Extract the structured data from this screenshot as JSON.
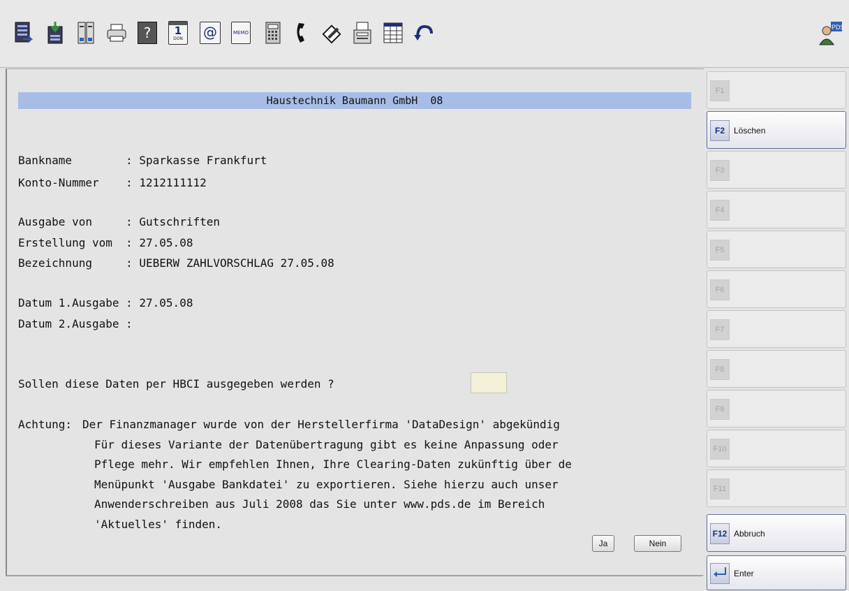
{
  "toolbar": {
    "icons": [
      "export-document-icon",
      "download-document-icon",
      "binder-icon",
      "printer-icon",
      "help-icon",
      "calendar-icon",
      "email-icon",
      "memo-icon",
      "calculator-icon",
      "phone-icon",
      "edit-icon",
      "fax-icon",
      "spreadsheet-icon",
      "undo-icon"
    ],
    "help_glyph": "?",
    "calendar_text": "1",
    "calendar_sub": "DON",
    "email_glyph": "@",
    "memo_text": "MEMO",
    "logo_text": "PDS"
  },
  "header": {
    "company": "Haustechnik Baumann GmbH  08"
  },
  "fields": [
    {
      "label": "Bankname        ",
      "value": ": Sparkasse Frankfurt"
    },
    {
      "label": "Konto-Nummer    ",
      "value": ": 1212111112"
    },
    {
      "label": "Ausgabe von     ",
      "value": ": Gutschriften"
    },
    {
      "label": "Erstellung vom  ",
      "value": ": 27.05.08"
    },
    {
      "label": "Bezeichnung     ",
      "value": ": UEBERW ZAHLVORSCHLAG 27.05.08"
    },
    {
      "label": "Datum 1.Ausgabe ",
      "value": ": 27.05.08"
    },
    {
      "label": "Datum 2.Ausgabe ",
      "value": ":"
    }
  ],
  "question": "Sollen diese Daten per HBCI ausgegeben werden ?",
  "hbci_input_value": "",
  "notice": {
    "prefix": "Achtung:",
    "lines": [
      "Der Finanzmanager wurde von der Herstellerfirma 'DataDesign' abgekündig",
      "Für dieses Variante der Datenübertragung gibt es keine Anpassung oder",
      "Pflege mehr. Wir empfehlen Ihnen, Ihre Clearing-Daten zukünftig über de",
      "Menüpunkt 'Ausgabe Bankdatei' zu exportieren. Siehe hierzu auch unser",
      "Anwenderschreiben aus Juli 2008 das Sie unter www.pds.de im Bereich",
      "'Aktuelles' finden."
    ]
  },
  "buttons": {
    "yes": "Ja",
    "no": "Nein"
  },
  "fkeys": [
    {
      "key": "F1",
      "label": "",
      "enabled": false
    },
    {
      "key": "F2",
      "label": "Löschen",
      "enabled": true
    },
    {
      "key": "F3",
      "label": "",
      "enabled": false
    },
    {
      "key": "F4",
      "label": "",
      "enabled": false
    },
    {
      "key": "F5",
      "label": "",
      "enabled": false
    },
    {
      "key": "F6",
      "label": "",
      "enabled": false
    },
    {
      "key": "F7",
      "label": "",
      "enabled": false
    },
    {
      "key": "F8",
      "label": "",
      "enabled": false
    },
    {
      "key": "F9",
      "label": "",
      "enabled": false
    },
    {
      "key": "F10",
      "label": "",
      "enabled": false
    },
    {
      "key": "F11",
      "label": "",
      "enabled": false
    },
    {
      "key": "F12",
      "label": "Abbruch",
      "enabled": true
    },
    {
      "key": "",
      "label": "Enter",
      "enabled": true,
      "icon": "enter-arrow-icon"
    }
  ],
  "colors": {
    "title_bar": "#a7bde6",
    "input_bg": "#f3f1d8",
    "fkey_active_text": "#1c2f7a"
  }
}
